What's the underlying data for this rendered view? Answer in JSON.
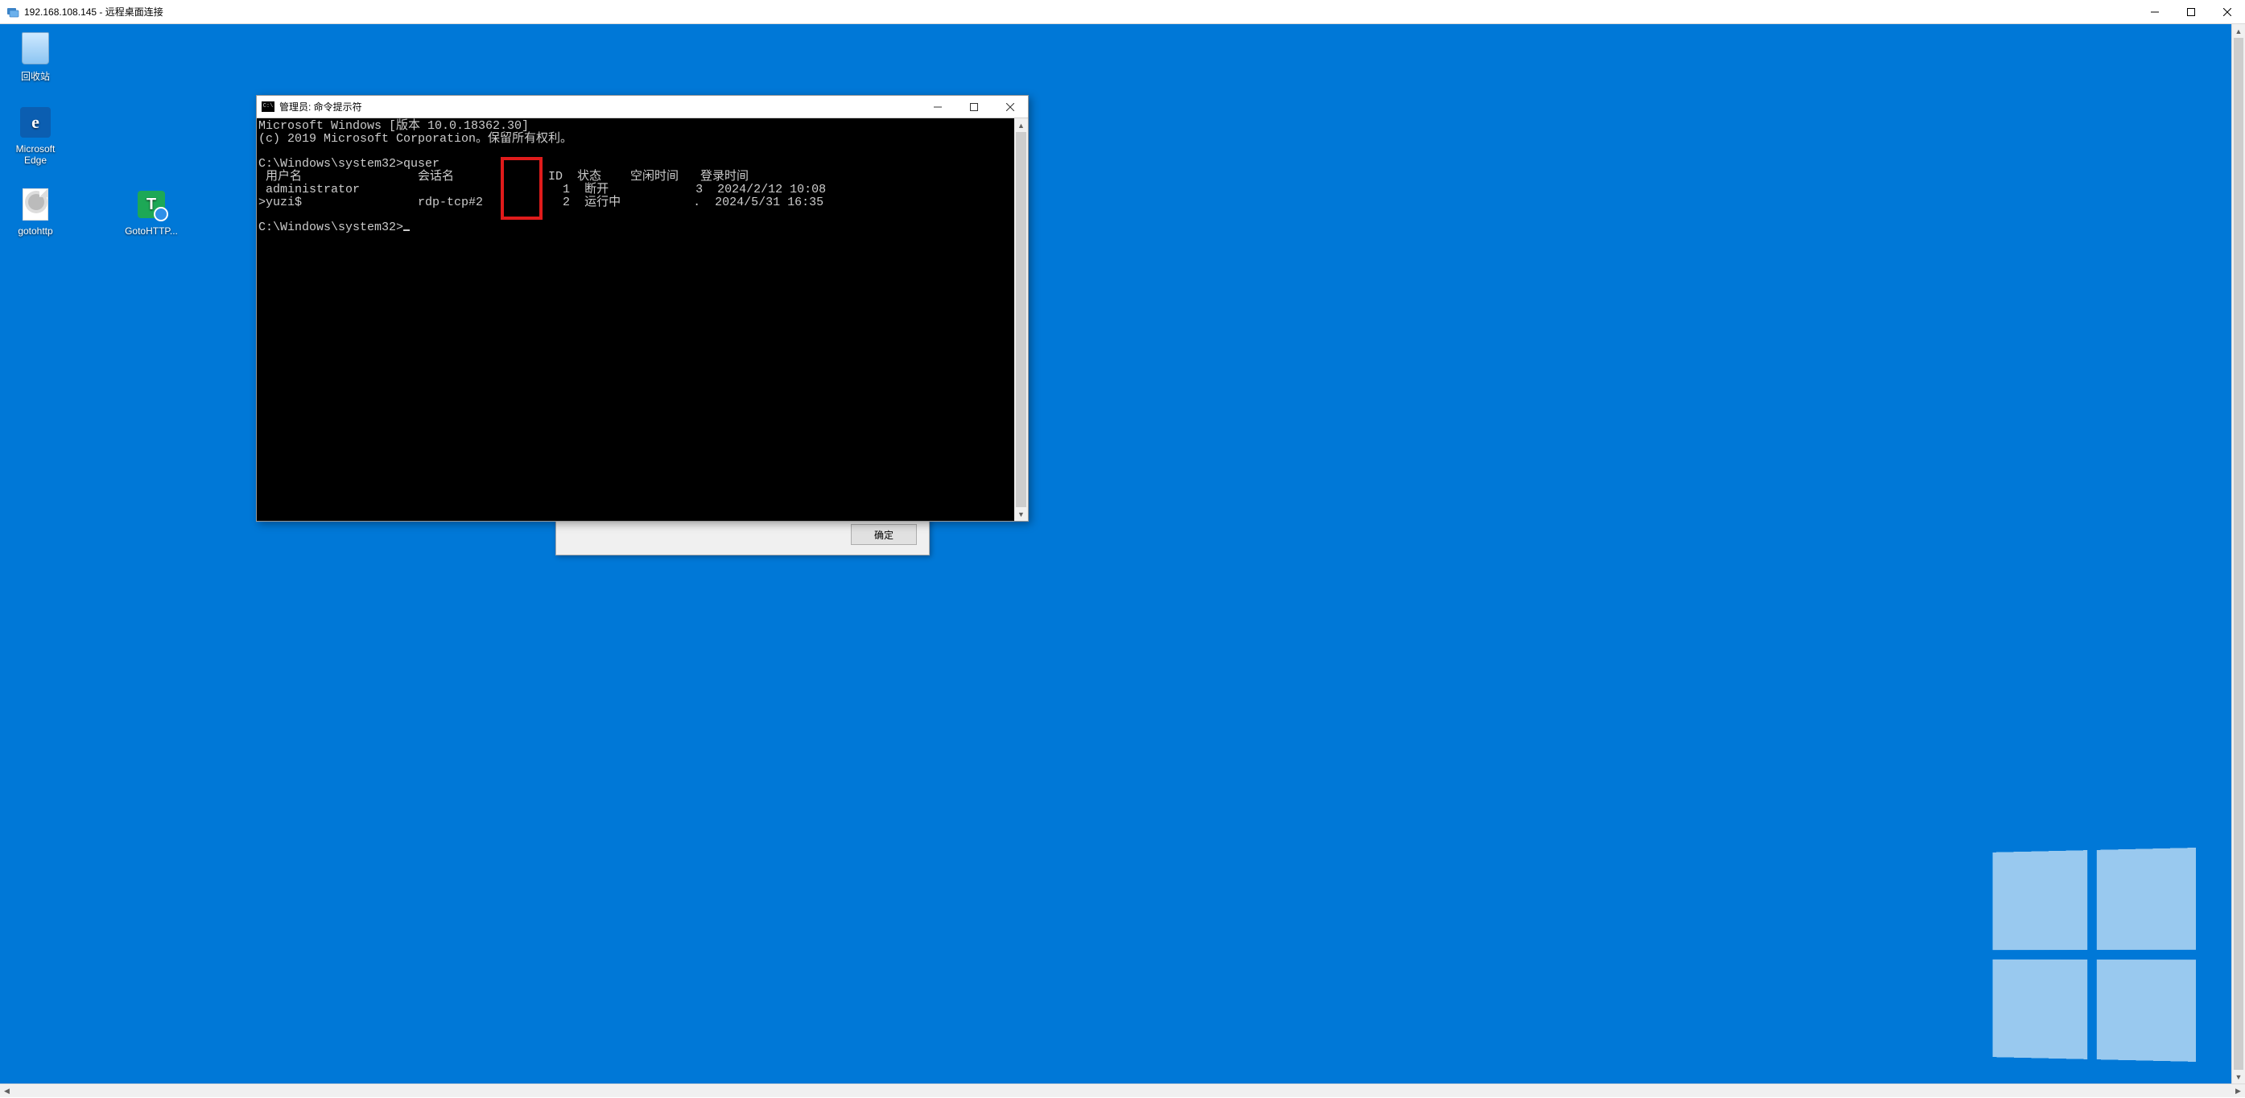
{
  "host": {
    "title": "192.168.108.145 - 远程桌面连接"
  },
  "desktop": {
    "icons": {
      "recycle": "回收站",
      "edge": "Microsoft Edge",
      "gotohttp_file": "gotohttp",
      "gotohttp_app": "GotoHTTP..."
    }
  },
  "dialog": {
    "ok_label": "确定"
  },
  "cmd": {
    "title": "管理员: 命令提示符",
    "banner_line1": "Microsoft Windows [版本 10.0.18362.30]",
    "banner_line2": "(c) 2019 Microsoft Corporation。保留所有权利。",
    "prompt1": "C:\\Windows\\system32>",
    "command1": "quser",
    "header": " 用户名                会话名             ID  状态    空闲时间   登录时间",
    "row1": " administrator                            1  断开            3  2024/2/12 10:08",
    "row2": ">yuzi$                rdp-tcp#2           2  运行中          .  2024/5/31 16:35",
    "prompt2": "C:\\Windows\\system32>"
  }
}
